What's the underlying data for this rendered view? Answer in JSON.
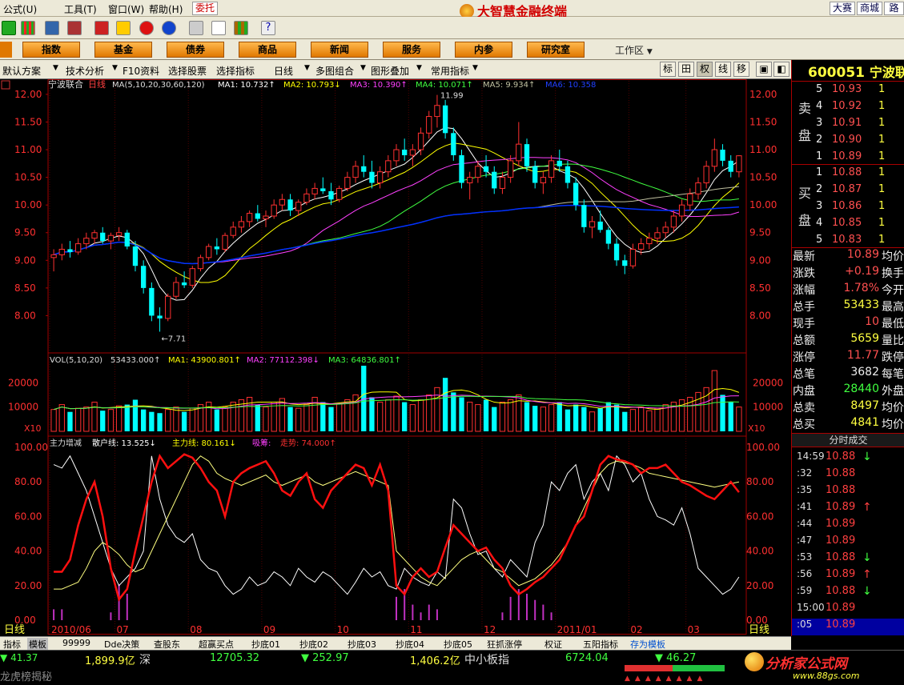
{
  "menubar": {
    "items": [
      "公式(U)",
      "工具(T)",
      "窗口(W)",
      "帮助(H)"
    ],
    "weituo": "委托",
    "app_title": "大智慧金融终端",
    "right_buttons": [
      "大赛",
      "商城",
      "路演"
    ]
  },
  "nav": {
    "buttons": [
      "指数",
      "基金",
      "债券",
      "商品",
      "新闻",
      "服务",
      "内参",
      "研究室"
    ],
    "workspace": "工作区"
  },
  "funcbar": {
    "items": [
      "默认方案",
      "技术分析",
      "F10资料",
      "选择股票",
      "选择指标",
      "日线",
      "多图组合",
      "图形叠加",
      "常用指标"
    ],
    "toggles": [
      "标",
      "田",
      "权",
      "线",
      "移"
    ]
  },
  "chart": {
    "stock_name": "宁波联合",
    "period": "日线",
    "ma_label": "MA(5,10,20,30,60,120)",
    "ma_values": [
      "MA1: 10.732↑",
      "MA2: 10.793↓",
      "MA3: 10.390↑",
      "MA4: 10.071↑",
      "MA5: 9.934↑",
      "MA6: 10.358"
    ],
    "high_label": "11.99",
    "low_label": "←7.71",
    "y_ticks": [
      "12.00",
      "11.50",
      "11.00",
      "10.50",
      "10.00",
      "9.50",
      "9.00",
      "8.50",
      "8.00"
    ],
    "vol_label": "VOL(5,10,20)",
    "vol_values": [
      "53433.000↑",
      "MA1: 43900.801↑",
      "MA2: 77112.398↓",
      "MA3: 64836.801↑"
    ],
    "vol_ticks": [
      "20000",
      "10000"
    ],
    "vol_unit": "X10",
    "ind_label": "主力增减",
    "ind_values": [
      "散户线: 13.525↓",
      "主力线: 80.161↓",
      "吸筹:",
      "走势: 74.000↑"
    ],
    "ind_ticks": [
      "100.00",
      "80.00",
      "60.00",
      "40.00",
      "20.00",
      "0.00"
    ],
    "x_labels": [
      "2010/06",
      "07",
      "08",
      "09",
      "10",
      "11",
      "12",
      "2011/01",
      "02",
      "03"
    ],
    "corner_period": "日线"
  },
  "tabs": [
    "指标",
    "模板",
    "99999",
    "Dde决策",
    "查股东",
    "超赢买点",
    "抄底01",
    "抄底02",
    "抄底03",
    "抄底04",
    "抄底05",
    "狂抓涨停",
    "权证",
    "五阳指标",
    "存为模板"
  ],
  "status": {
    "s1": "41.37",
    "s2": "1,899.9亿",
    "s3": "深",
    "s4": "12705.32",
    "s5": "252.97",
    "s6": "1,406.2亿",
    "s7": "中小板指",
    "s8": "6724.04",
    "s9": "46.27",
    "s10": "龙虎榜揭秘",
    "logo1": "分析家公式网",
    "logo2": "www.88gs.com"
  },
  "rpanel": {
    "code": "600051",
    "name": "宁波联",
    "sell_label": "卖盘",
    "buy_label": "买盘",
    "sell": [
      {
        "l": "5",
        "p": "10.93",
        "v": "1"
      },
      {
        "l": "4",
        "p": "10.92",
        "v": "1"
      },
      {
        "l": "3",
        "p": "10.91",
        "v": "1"
      },
      {
        "l": "2",
        "p": "10.90",
        "v": "1"
      },
      {
        "l": "1",
        "p": "10.89",
        "v": "1"
      }
    ],
    "buy": [
      {
        "l": "1",
        "p": "10.88",
        "v": "1"
      },
      {
        "l": "2",
        "p": "10.87",
        "v": "1"
      },
      {
        "l": "3",
        "p": "10.86",
        "v": "1"
      },
      {
        "l": "4",
        "p": "10.85",
        "v": "1"
      },
      {
        "l": "5",
        "p": "10.83",
        "v": "1"
      }
    ],
    "stats": [
      {
        "k": "最新",
        "v": "10.89",
        "c": "#ff5050",
        "k2": "均价"
      },
      {
        "k": "涨跌",
        "v": "+0.19",
        "c": "#ff5050",
        "k2": "换手"
      },
      {
        "k": "涨幅",
        "v": "1.78%",
        "c": "#ff5050",
        "k2": "今开"
      },
      {
        "k": "总手",
        "v": "53433",
        "c": "#ffff40",
        "k2": "最高"
      },
      {
        "k": "现手",
        "v": "10",
        "c": "#ff5050",
        "k2": "最低"
      },
      {
        "k": "总额",
        "v": "5659",
        "c": "#ffff40",
        "k2": "量比"
      },
      {
        "k": "涨停",
        "v": "11.77",
        "c": "#ff5050",
        "k2": "跌停"
      },
      {
        "k": "总笔",
        "v": "3682",
        "c": "#eee",
        "k2": "每笔"
      },
      {
        "k": "内盘",
        "v": "28440",
        "c": "#40ff40",
        "k2": "外盘"
      },
      {
        "k": "总卖",
        "v": "8497",
        "c": "#ffff40",
        "k2": "均价"
      },
      {
        "k": "总买",
        "v": "4841",
        "c": "#ffff40",
        "k2": "均价"
      }
    ],
    "trade_title": "分时成交",
    "trades": [
      {
        "t": "14:59",
        "p": "10.88",
        "a": "↓"
      },
      {
        "t": ":32",
        "p": "10.88",
        "a": ""
      },
      {
        "t": ":35",
        "p": "10.88",
        "a": ""
      },
      {
        "t": ":41",
        "p": "10.89",
        "a": "↑"
      },
      {
        "t": ":44",
        "p": "10.89",
        "a": ""
      },
      {
        "t": ":47",
        "p": "10.89",
        "a": ""
      },
      {
        "t": ":53",
        "p": "10.88",
        "a": "↓"
      },
      {
        "t": ":56",
        "p": "10.89",
        "a": "↑"
      },
      {
        "t": ":59",
        "p": "10.88",
        "a": "↓"
      },
      {
        "t": "15:00",
        "p": "10.89",
        "a": ""
      },
      {
        "t": ":05",
        "p": "10.89",
        "a": ""
      }
    ]
  },
  "colors": {
    "up": "#ff3030",
    "down": "#00ffff",
    "ma1": "#ffffff",
    "ma2": "#ffff00",
    "ma3": "#ff40ff",
    "ma4": "#40ff40",
    "ma5": "#c0c0a0",
    "ma6": "#0030ff",
    "retail": "#ffffff",
    "main": "#ff1010",
    "trend": "#ffff80",
    "accum": "#c030c0"
  },
  "chart_data": {
    "type": "candlestick",
    "price_range": [
      7.5,
      12.1
    ],
    "vol_range": [
      0,
      27000
    ],
    "ind_range": [
      0,
      100
    ],
    "high": 11.99,
    "low": 7.71,
    "bars": [
      [
        9.05,
        9.2,
        8.8,
        9.1
      ],
      [
        9.1,
        9.3,
        9.0,
        9.2
      ],
      [
        9.2,
        9.35,
        9.05,
        9.15
      ],
      [
        9.15,
        9.4,
        9.1,
        9.3
      ],
      [
        9.3,
        9.5,
        9.2,
        9.4
      ],
      [
        9.4,
        9.55,
        9.3,
        9.5
      ],
      [
        9.5,
        9.6,
        9.3,
        9.35
      ],
      [
        9.35,
        9.5,
        9.2,
        9.45
      ],
      [
        9.45,
        9.6,
        9.35,
        9.5
      ],
      [
        9.5,
        9.55,
        9.2,
        9.25
      ],
      [
        9.25,
        9.35,
        8.8,
        8.9
      ],
      [
        8.9,
        9.0,
        8.4,
        8.5
      ],
      [
        8.5,
        8.6,
        7.9,
        8.0
      ],
      [
        8.0,
        8.15,
        7.71,
        7.95
      ],
      [
        7.95,
        8.4,
        7.9,
        8.35
      ],
      [
        8.35,
        8.7,
        8.3,
        8.6
      ],
      [
        8.6,
        8.8,
        8.5,
        8.55
      ],
      [
        8.55,
        8.9,
        8.5,
        8.85
      ],
      [
        8.85,
        9.1,
        8.8,
        9.05
      ],
      [
        9.05,
        9.3,
        9.0,
        9.25
      ],
      [
        9.25,
        9.4,
        9.1,
        9.2
      ],
      [
        9.2,
        9.5,
        9.15,
        9.45
      ],
      [
        9.45,
        9.7,
        9.4,
        9.6
      ],
      [
        9.6,
        9.8,
        9.5,
        9.7
      ],
      [
        9.7,
        9.9,
        9.6,
        9.85
      ],
      [
        9.85,
        10.0,
        9.7,
        9.75
      ],
      [
        9.75,
        9.9,
        9.6,
        9.8
      ],
      [
        9.8,
        10.1,
        9.75,
        10.0
      ],
      [
        10.0,
        10.2,
        9.9,
        10.1
      ],
      [
        10.1,
        10.2,
        9.8,
        9.9
      ],
      [
        9.9,
        10.1,
        9.8,
        10.05
      ],
      [
        10.05,
        10.3,
        10.0,
        10.2
      ],
      [
        10.2,
        10.4,
        10.1,
        10.3
      ],
      [
        10.3,
        10.5,
        10.2,
        10.25
      ],
      [
        10.25,
        10.4,
        10.0,
        10.1
      ],
      [
        10.1,
        10.35,
        10.05,
        10.3
      ],
      [
        10.3,
        10.6,
        10.25,
        10.5
      ],
      [
        10.5,
        10.8,
        10.4,
        10.7
      ],
      [
        10.7,
        10.9,
        10.5,
        10.6
      ],
      [
        10.6,
        10.8,
        10.3,
        10.4
      ],
      [
        10.4,
        10.7,
        10.3,
        10.6
      ],
      [
        10.6,
        10.9,
        10.5,
        10.8
      ],
      [
        10.8,
        11.1,
        10.7,
        11.0
      ],
      [
        11.0,
        11.2,
        10.8,
        10.9
      ],
      [
        10.9,
        11.1,
        10.7,
        11.0
      ],
      [
        11.0,
        11.4,
        10.9,
        11.3
      ],
      [
        11.3,
        11.7,
        11.2,
        11.6
      ],
      [
        11.6,
        11.99,
        11.4,
        11.8
      ],
      [
        11.8,
        11.9,
        11.2,
        11.3
      ],
      [
        11.3,
        11.4,
        10.8,
        10.9
      ],
      [
        10.9,
        11.0,
        10.3,
        10.4
      ],
      [
        10.4,
        10.6,
        10.1,
        10.5
      ],
      [
        10.5,
        10.8,
        10.4,
        10.7
      ],
      [
        10.7,
        10.9,
        10.5,
        10.6
      ],
      [
        10.6,
        10.7,
        10.2,
        10.3
      ],
      [
        10.3,
        10.6,
        10.2,
        10.5
      ],
      [
        10.5,
        10.9,
        10.4,
        10.8
      ],
      [
        10.8,
        11.5,
        10.7,
        11.1
      ],
      [
        11.1,
        11.2,
        10.6,
        10.7
      ],
      [
        10.7,
        10.8,
        10.3,
        10.4
      ],
      [
        10.4,
        10.6,
        10.2,
        10.5
      ],
      [
        10.5,
        10.9,
        10.4,
        10.8
      ],
      [
        10.8,
        11.0,
        10.6,
        10.7
      ],
      [
        10.7,
        10.8,
        10.3,
        10.4
      ],
      [
        10.4,
        10.5,
        9.9,
        10.0
      ],
      [
        10.0,
        10.1,
        9.5,
        9.6
      ],
      [
        9.6,
        9.8,
        9.4,
        9.7
      ],
      [
        9.7,
        9.9,
        9.5,
        9.55
      ],
      [
        9.55,
        9.6,
        9.2,
        9.3
      ],
      [
        9.3,
        9.4,
        8.9,
        9.0
      ],
      [
        9.0,
        9.1,
        8.75,
        8.9
      ],
      [
        8.9,
        9.3,
        8.85,
        9.2
      ],
      [
        9.2,
        9.4,
        9.1,
        9.3
      ],
      [
        9.3,
        9.5,
        9.2,
        9.4
      ],
      [
        9.4,
        9.6,
        9.3,
        9.5
      ],
      [
        9.5,
        9.7,
        9.4,
        9.6
      ],
      [
        9.6,
        9.9,
        9.5,
        9.8
      ],
      [
        9.8,
        10.1,
        9.7,
        10.0
      ],
      [
        10.0,
        10.3,
        9.9,
        10.2
      ],
      [
        10.2,
        10.5,
        10.1,
        10.4
      ],
      [
        10.4,
        10.8,
        10.3,
        10.7
      ],
      [
        10.7,
        11.2,
        10.6,
        11.0
      ],
      [
        11.0,
        11.1,
        10.7,
        10.8
      ],
      [
        10.8,
        10.9,
        10.5,
        10.6
      ],
      [
        10.6,
        10.9,
        10.5,
        10.89
      ]
    ],
    "volume": [
      9000,
      11000,
      8000,
      9500,
      10000,
      12000,
      8500,
      9000,
      10500,
      11000,
      13000,
      9000,
      8000,
      7500,
      9000,
      10000,
      8000,
      9500,
      11000,
      12000,
      9000,
      10000,
      12000,
      13000,
      14000,
      11000,
      10000,
      12000,
      13500,
      10000,
      9500,
      11000,
      14000,
      12000,
      10000,
      11500,
      13000,
      15000,
      27000,
      14000,
      12000,
      13000,
      14500,
      12000,
      11000,
      13000,
      15000,
      18000,
      22000,
      16000,
      14000,
      12000,
      11000,
      13000,
      10000,
      12000,
      13000,
      15000,
      12000,
      10500,
      10000,
      11000,
      12000,
      9000,
      11000,
      10000,
      8000,
      9500,
      12000,
      11000,
      8000,
      9000,
      10000,
      8500,
      9500,
      11000,
      12000,
      13000,
      14000,
      16000,
      18000,
      25000,
      15000,
      12000,
      10000
    ],
    "retail": [
      90,
      88,
      95,
      85,
      75,
      60,
      45,
      30,
      20,
      25,
      30,
      40,
      95,
      70,
      55,
      48,
      45,
      50,
      35,
      30,
      28,
      20,
      15,
      18,
      25,
      20,
      22,
      28,
      25,
      20,
      30,
      25,
      22,
      28,
      25,
      20,
      15,
      22,
      30,
      25,
      28,
      20,
      18,
      30,
      25,
      22,
      20,
      28,
      24,
      70,
      65,
      50,
      38,
      40,
      30,
      25,
      35,
      30,
      25,
      45,
      55,
      80,
      75,
      85,
      90,
      70,
      80,
      85,
      75,
      95,
      90,
      80,
      85,
      70,
      60,
      58,
      55,
      65,
      50,
      30,
      25,
      20,
      15,
      18,
      25
    ],
    "main": [
      28,
      28,
      35,
      55,
      70,
      80,
      60,
      30,
      12,
      18,
      40,
      60,
      80,
      95,
      88,
      92,
      96,
      94,
      88,
      80,
      75,
      60,
      80,
      85,
      88,
      90,
      92,
      85,
      75,
      72,
      80,
      85,
      70,
      65,
      75,
      80,
      85,
      90,
      88,
      78,
      90,
      75,
      20,
      15,
      25,
      30,
      25,
      28,
      42,
      55,
      50,
      45,
      40,
      42,
      35,
      30,
      20,
      15,
      18,
      22,
      25,
      30,
      35,
      45,
      55,
      60,
      75,
      90,
      95,
      93,
      92,
      90,
      85,
      88,
      88,
      90,
      85,
      80,
      78,
      75,
      72,
      70,
      75,
      80,
      74
    ],
    "trend": [
      18,
      18,
      20,
      22,
      30,
      40,
      45,
      42,
      38,
      32,
      28,
      30,
      40,
      50,
      60,
      70,
      80,
      90,
      95,
      92,
      85,
      82,
      80,
      78,
      80,
      82,
      84,
      80,
      78,
      80,
      82,
      84,
      80,
      78,
      80,
      82,
      84,
      86,
      84,
      82,
      80,
      78,
      40,
      35,
      30,
      25,
      22,
      20,
      25,
      30,
      35,
      38,
      40,
      35,
      30,
      28,
      24,
      20,
      22,
      24,
      28,
      32,
      38,
      45,
      55,
      65,
      75,
      85,
      90,
      92,
      91,
      90,
      88,
      85,
      84,
      83,
      82,
      81,
      80,
      79,
      78,
      77,
      78,
      79,
      80
    ]
  }
}
